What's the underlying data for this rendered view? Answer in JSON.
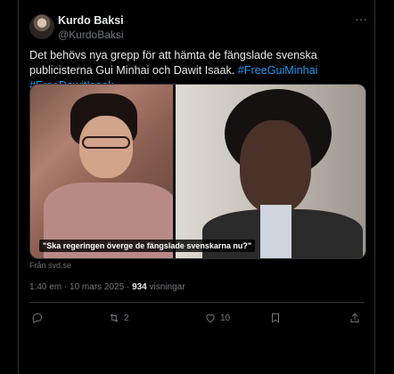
{
  "author": {
    "name": "Kurdo Baksi",
    "handle": "@KurdoBaksi"
  },
  "tweet": {
    "text": "Det behövs nya grepp för att hämta de fängslade svenska publicisterna Gui Minhai och Dawit Isaak.",
    "hashtags": [
      "#FreeGuiMinhai",
      "#FreeDawitIsaak"
    ]
  },
  "media": {
    "caption": "\"Ska regeringen överge de fängslade svenskarna nu?\"",
    "source": "Från svd.se"
  },
  "meta": {
    "time": "1:40 em · 10 mars 2025 · ",
    "views_count": "934",
    "views_label": " visningar"
  },
  "actions": {
    "replies": "",
    "retweets": "2",
    "likes": "10"
  },
  "icons": {
    "more": "more-icon",
    "reply": "reply-icon",
    "retweet": "retweet-icon",
    "like": "heart-icon",
    "bookmark": "bookmark-icon",
    "share": "share-icon"
  },
  "colors": {
    "background": "#000000",
    "text": "#e7e9ea",
    "secondary": "#71767b",
    "accent": "#1d9bf0",
    "border": "#2f3336"
  }
}
